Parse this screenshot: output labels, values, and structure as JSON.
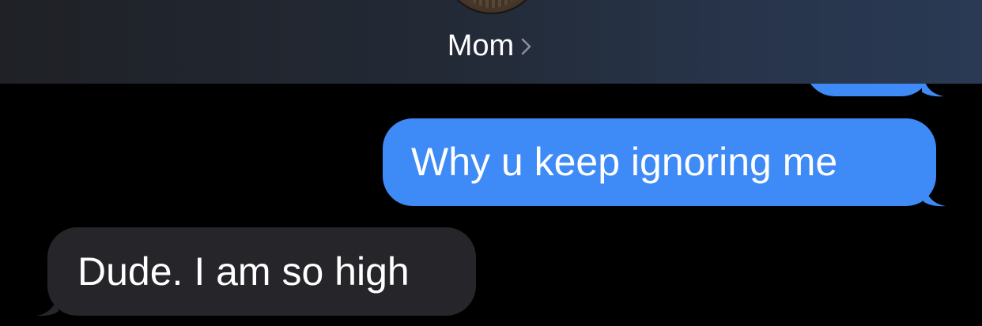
{
  "header": {
    "contact_name": "Mom",
    "avatar_icon": "contact-photo-icon",
    "chevron_icon": "chevron-right-icon"
  },
  "messages": [
    {
      "direction": "sent",
      "text": ""
    },
    {
      "direction": "sent",
      "text": "Why u keep ignoring me"
    },
    {
      "direction": "received",
      "text": "Dude. I am so high"
    }
  ],
  "colors": {
    "sent_bubble": "#3e8af7",
    "received_bubble": "#26252a",
    "background": "#000000",
    "header_gradient_start": "#1f2126",
    "header_gradient_end": "#2a3a54",
    "text": "#ffffff",
    "chevron": "#8e8e93"
  }
}
